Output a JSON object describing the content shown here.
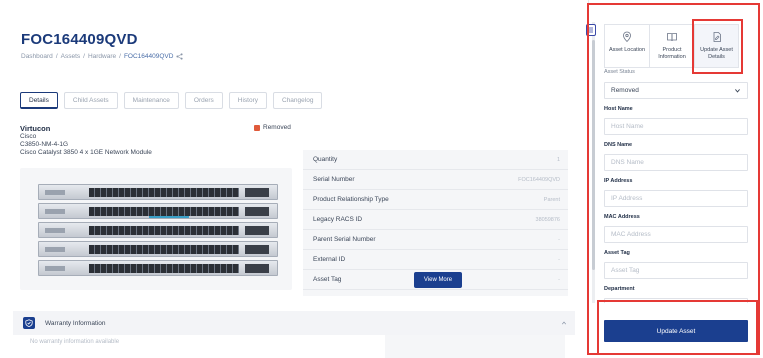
{
  "asset": {
    "title": "FOC164409QVD",
    "breadcrumb": [
      "Dashboard",
      "/",
      "Assets",
      "/",
      "Hardware",
      "/",
      "FOC164409QVD"
    ],
    "status": "Removed",
    "status_color": "#e05a3a"
  },
  "tabs": [
    {
      "label": "Details",
      "active": true
    },
    {
      "label": "Child Assets"
    },
    {
      "label": "Maintenance"
    },
    {
      "label": "Orders"
    },
    {
      "label": "History"
    },
    {
      "label": "Changelog"
    }
  ],
  "product": {
    "vendor": "Virtucon",
    "manufacturer": "Cisco",
    "model": "C3850-NM-4-1G",
    "description": "Cisco Catalyst 3850 4 x 1GE Network Module"
  },
  "details": [
    {
      "key": "Quantity",
      "value": "1"
    },
    {
      "key": "Serial Number",
      "value": "FOC164409QVD"
    },
    {
      "key": "Product Relationship Type",
      "value": "Parent"
    },
    {
      "key": "Legacy RACS ID",
      "value": "38059876"
    },
    {
      "key": "Parent Serial Number",
      "value": "-"
    },
    {
      "key": "External ID",
      "value": "-"
    },
    {
      "key": "Asset Tag",
      "value": "-"
    }
  ],
  "view_more_label": "View More",
  "warranty": {
    "title": "Warranty Information",
    "empty_text": "No warranty information available"
  },
  "panel": {
    "actions": [
      {
        "label": "Asset Location",
        "icon": "location-pin-icon"
      },
      {
        "label": "Product Information",
        "icon": "book-icon"
      },
      {
        "label": "Update Asset Details",
        "icon": "document-edit-icon",
        "active": true
      }
    ],
    "cutoff_label": "Asset Status",
    "status_value": "Removed",
    "fields": [
      {
        "label": "Host Name",
        "placeholder": "Host Name"
      },
      {
        "label": "DNS Name",
        "placeholder": "DNS Name"
      },
      {
        "label": "IP Address",
        "placeholder": "IP Address"
      },
      {
        "label": "MAC Address",
        "placeholder": "MAC Address"
      },
      {
        "label": "Asset Tag",
        "placeholder": "Asset Tag"
      },
      {
        "label": "Department",
        "placeholder": "Department"
      }
    ],
    "submit_label": "Update Asset"
  },
  "colors": {
    "brand": "#1b3f8f",
    "highlight": "#e53935"
  }
}
